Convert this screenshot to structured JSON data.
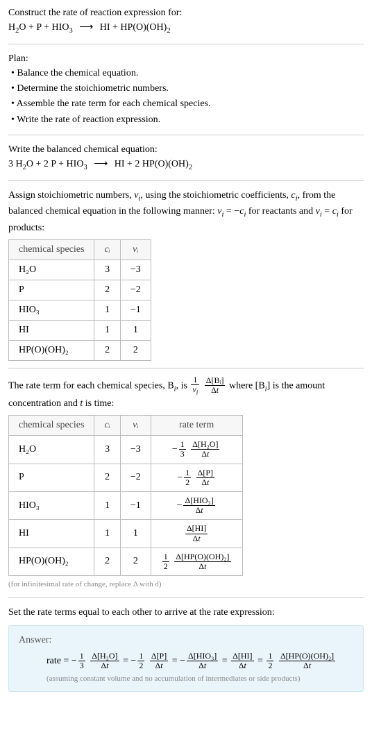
{
  "intro": {
    "line1": "Construct the rate of reaction expression for:",
    "eq_lhs1": "H",
    "eq_lhs1_sub": "2",
    "eq_lhs2": "O + P + HIO",
    "eq_lhs2_sub": "3",
    "arrow": "⟶",
    "eq_rhs1": "HI + HP(O)(OH)",
    "eq_rhs1_sub": "2"
  },
  "plan": {
    "title": "Plan:",
    "b1": "• Balance the chemical equation.",
    "b2": "• Determine the stoichiometric numbers.",
    "b3": "• Assemble the rate term for each chemical species.",
    "b4": "• Write the rate of reaction expression."
  },
  "balanced": {
    "line": "Write the balanced chemical equation:",
    "c1": "3 H",
    "c1s": "2",
    "c2": "O + 2 P + HIO",
    "c2s": "3",
    "arrow": "⟶",
    "r1": "HI + 2 HP(O)(OH)",
    "r1s": "2"
  },
  "assign": {
    "p1a": "Assign stoichiometric numbers, ",
    "nu": "ν",
    "nu_sub": "i",
    "p1b": ", using the stoichiometric coefficients, ",
    "ci": "c",
    "ci_sub": "i",
    "p1c": ", from the balanced chemical equation in the following manner: ",
    "rel1a": "ν",
    "rel1b": " = −",
    "rel1c": "c",
    "p1d": " for reactants and ",
    "rel2a": "ν",
    "rel2b": " = ",
    "rel2c": "c",
    "p1e": " for products:"
  },
  "table1": {
    "h1": "chemical species",
    "h2": "cᵢ",
    "h3": "νᵢ",
    "r1": {
      "s": "H₂O",
      "c": "3",
      "n": "−3"
    },
    "r2": {
      "s": "P",
      "c": "2",
      "n": "−2"
    },
    "r3": {
      "s": "HIO₃",
      "c": "1",
      "n": "−1"
    },
    "r4": {
      "s": "HI",
      "c": "1",
      "n": "1"
    },
    "r5": {
      "s": "HP(O)(OH)₂",
      "c": "2",
      "n": "2"
    }
  },
  "rate_intro": {
    "p1": "The rate term for each chemical species, B",
    "bi_sub": "i",
    "p2": ", is ",
    "frac1_num": "1",
    "frac1_den_a": "ν",
    "frac1_den_sub": "i",
    "frac2_num": "Δ[Bᵢ]",
    "frac2_den": "Δt",
    "p3": " where [B",
    "p3_sub": "i",
    "p4": "] is the amount concentration and ",
    "t": "t",
    "p5": " is time:"
  },
  "table2": {
    "h1": "chemical species",
    "h2": "cᵢ",
    "h3": "νᵢ",
    "h4": "rate term",
    "r1": {
      "s": "H₂O",
      "c": "3",
      "n": "−3",
      "sign": "−",
      "cn": "1",
      "cd": "3",
      "num": "Δ[H₂O]",
      "den": "Δt"
    },
    "r2": {
      "s": "P",
      "c": "2",
      "n": "−2",
      "sign": "−",
      "cn": "1",
      "cd": "2",
      "num": "Δ[P]",
      "den": "Δt"
    },
    "r3": {
      "s": "HIO₃",
      "c": "1",
      "n": "−1",
      "sign": "−",
      "cn": "",
      "cd": "",
      "num": "Δ[HIO₃]",
      "den": "Δt"
    },
    "r4": {
      "s": "HI",
      "c": "1",
      "n": "1",
      "sign": "",
      "cn": "",
      "cd": "",
      "num": "Δ[HI]",
      "den": "Δt"
    },
    "r5": {
      "s": "HP(O)(OH)₂",
      "c": "2",
      "n": "2",
      "sign": "",
      "cn": "1",
      "cd": "2",
      "num": "Δ[HP(O)(OH)₂]",
      "den": "Δt"
    }
  },
  "footnote": "(for infinitesimal rate of change, replace Δ with d)",
  "set_equal": "Set the rate terms equal to each other to arrive at the rate expression:",
  "answer": {
    "label": "Answer:",
    "rate_word": "rate = ",
    "t1": {
      "sign": "−",
      "cn": "1",
      "cd": "3",
      "num": "Δ[H₂O]",
      "den": "Δt"
    },
    "t2": {
      "sign": "−",
      "cn": "1",
      "cd": "2",
      "num": "Δ[P]",
      "den": "Δt"
    },
    "t3": {
      "sign": "−",
      "cn": "",
      "cd": "",
      "num": "Δ[HIO₃]",
      "den": "Δt"
    },
    "t4": {
      "sign": "",
      "cn": "",
      "cd": "",
      "num": "Δ[HI]",
      "den": "Δt"
    },
    "t5": {
      "sign": "",
      "cn": "1",
      "cd": "2",
      "num": "Δ[HP(O)(OH)₂]",
      "den": "Δt"
    },
    "eq": " = ",
    "assume": "(assuming constant volume and no accumulation of intermediates or side products)"
  },
  "chart_data": {
    "type": "table",
    "tables": [
      {
        "columns": [
          "chemical species",
          "c_i",
          "nu_i"
        ],
        "rows": [
          [
            "H2O",
            3,
            -3
          ],
          [
            "P",
            2,
            -2
          ],
          [
            "HIO3",
            1,
            -1
          ],
          [
            "HI",
            1,
            1
          ],
          [
            "HP(O)(OH)2",
            2,
            2
          ]
        ]
      },
      {
        "columns": [
          "chemical species",
          "c_i",
          "nu_i",
          "rate term"
        ],
        "rows": [
          [
            "H2O",
            3,
            -3,
            "-(1/3) Δ[H2O]/Δt"
          ],
          [
            "P",
            2,
            -2,
            "-(1/2) Δ[P]/Δt"
          ],
          [
            "HIO3",
            1,
            -1,
            "- Δ[HIO3]/Δt"
          ],
          [
            "HI",
            1,
            1,
            "Δ[HI]/Δt"
          ],
          [
            "HP(O)(OH)2",
            2,
            2,
            "(1/2) Δ[HP(O)(OH)2]/Δt"
          ]
        ]
      }
    ]
  }
}
